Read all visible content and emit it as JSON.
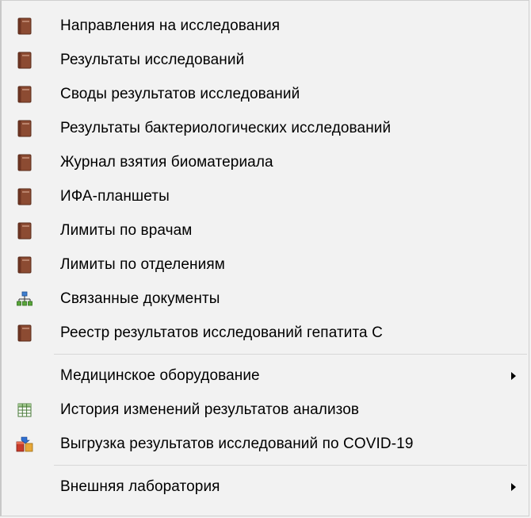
{
  "menu": {
    "items": [
      {
        "label": "Направления на исследования",
        "icon": "book-icon"
      },
      {
        "label": "Результаты исследований",
        "icon": "book-icon"
      },
      {
        "label": "Своды результатов исследований",
        "icon": "book-icon"
      },
      {
        "label": "Результаты бактериологических исследований",
        "icon": "book-icon"
      },
      {
        "label": "Журнал взятия биоматериала",
        "icon": "book-icon"
      },
      {
        "label": "ИФА-планшеты",
        "icon": "book-icon"
      },
      {
        "label": "Лимиты по врачам",
        "icon": "book-icon"
      },
      {
        "label": "Лимиты по отделениям",
        "icon": "book-icon"
      },
      {
        "label": "Связанные документы",
        "icon": "hierarchy-icon"
      },
      {
        "label": "Реестр результатов исследований гепатита С",
        "icon": "book-icon"
      },
      {
        "label": "Медицинское оборудование",
        "icon": "none",
        "submenu": true
      },
      {
        "label": "История изменений результатов анализов",
        "icon": "table-grid-icon"
      },
      {
        "label": "Выгрузка результатов исследований по COVID-19",
        "icon": "export-icon"
      },
      {
        "label": "Внешняя лаборатория",
        "icon": "none",
        "submenu": true
      }
    ]
  }
}
